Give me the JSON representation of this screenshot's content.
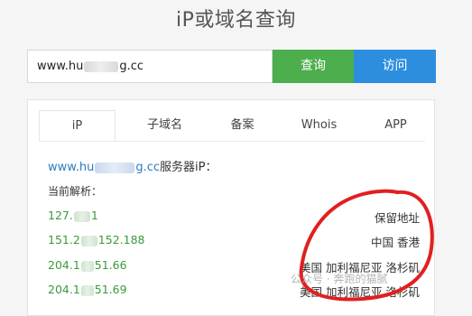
{
  "page": {
    "title": "iP或域名查询"
  },
  "search": {
    "value": "www.hu███g.cc",
    "value_prefix": "www.hu",
    "value_suffix": "g.cc",
    "query_label": "查询",
    "visit_label": "访问"
  },
  "tabs": [
    {
      "label": "iP",
      "active": true
    },
    {
      "label": "子域名",
      "active": false
    },
    {
      "label": "备案",
      "active": false
    },
    {
      "label": "Whois",
      "active": false
    },
    {
      "label": "APP",
      "active": false
    }
  ],
  "result": {
    "server_prefix": "www.hu",
    "server_suffix": "g.cc",
    "server_label": "服务器iP：",
    "current_label": "当前解析：",
    "rows": [
      {
        "ip_prefix": "127.",
        "ip_suffix": "1",
        "location": "保留地址"
      },
      {
        "ip_prefix": "151.2",
        "ip_suffix": "152.188",
        "location": "中国 香港"
      },
      {
        "ip_prefix": "204.1",
        "ip_suffix": "51.66",
        "location": "美国 加利福尼亚 洛杉矶"
      },
      {
        "ip_prefix": "204.1",
        "ip_suffix": "51.69",
        "location": "美国 加利福尼亚 洛杉矶"
      }
    ]
  },
  "colors": {
    "query_button": "#4cae4c",
    "visit_button": "#2d8ee0",
    "ip_text": "#3a9a3a",
    "link": "#2d7bc1",
    "annotation": "#e02020"
  },
  "watermark": "公众号 · 奔跑的猫腻"
}
